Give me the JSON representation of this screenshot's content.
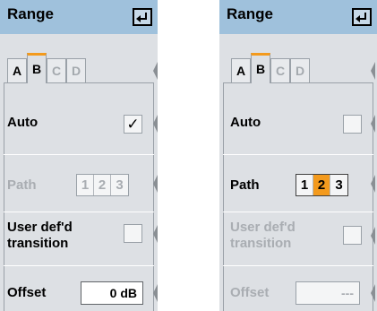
{
  "panels": [
    {
      "title": "Range",
      "tabs": [
        "A",
        "B",
        "C",
        "D"
      ],
      "active_tab": "B",
      "auto": {
        "label": "Auto",
        "checked": true,
        "check_glyph": "✓"
      },
      "path": {
        "label": "Path",
        "options": [
          "1",
          "2",
          "3"
        ],
        "selected": null,
        "enabled": false
      },
      "transition": {
        "label_line1": "User def'd",
        "label_line2": "transition",
        "checked": false,
        "enabled": true
      },
      "offset": {
        "label": "Offset",
        "value": "0 dB",
        "enabled": true
      }
    },
    {
      "title": "Range",
      "tabs": [
        "A",
        "B",
        "C",
        "D"
      ],
      "active_tab": "B",
      "auto": {
        "label": "Auto",
        "checked": false,
        "check_glyph": ""
      },
      "path": {
        "label": "Path",
        "options": [
          "1",
          "2",
          "3"
        ],
        "selected": "2",
        "enabled": true
      },
      "transition": {
        "label_line1": "User def'd",
        "label_line2": "transition",
        "checked": false,
        "enabled": false
      },
      "offset": {
        "label": "Offset",
        "value": "---",
        "enabled": false
      }
    }
  ],
  "icons": {
    "enter": "enter-return-icon",
    "spinner": "side-scroll-indicator-icon"
  },
  "colors": {
    "titlebar": "#9fc1dc",
    "content": "#dde0e4",
    "accent": "#f39a1d",
    "disabled_text": "#a9adb2"
  }
}
